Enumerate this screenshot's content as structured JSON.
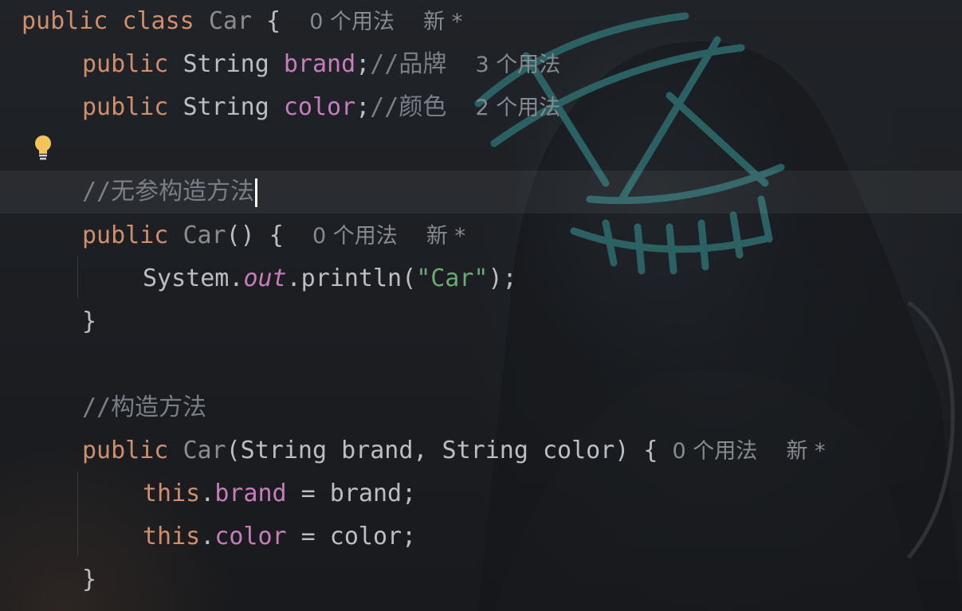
{
  "colors": {
    "keyword": "#cf8e6d",
    "class_name": "#8c8c8c",
    "field": "#c77dbb",
    "string": "#6aab73",
    "comment": "#7a7e85",
    "inlay_hint": "#868a91",
    "background": "#1e1f22",
    "bulb": "#f2c55c"
  },
  "icons": {
    "bulb": "lightbulb-icon"
  },
  "code": {
    "line1": {
      "kw_public": "public",
      "kw_class": "class",
      "name": "Car",
      "brace": "{",
      "hint_usages": "0 个用法",
      "hint_new": "新 *"
    },
    "line2": {
      "kw_public": "public",
      "type": "String",
      "field": "brand",
      "semi": ";",
      "comment": "//品牌",
      "hint_usages": "3 个用法"
    },
    "line3": {
      "kw_public": "public",
      "type": "String",
      "field": "color",
      "semi": ";",
      "comment": "//颜色",
      "hint_usages": "2 个用法"
    },
    "line5": {
      "comment": "//无参构造方法"
    },
    "line6": {
      "kw_public": "public",
      "name": "Car",
      "parens": "() {",
      "hint_usages": "0 个用法",
      "hint_new": "新 *"
    },
    "line7": {
      "system": "System.",
      "out": "out",
      "println": ".println(",
      "string": "\"Car\"",
      "end": ");"
    },
    "line8": {
      "brace": "}"
    },
    "line10": {
      "comment": "//构造方法"
    },
    "line11": {
      "kw_public": "public",
      "name": "Car",
      "params": "(String brand, String color) {",
      "hint_usages": "0 个用法",
      "hint_new": "新 *"
    },
    "line12": {
      "kw_this": "this",
      "dot": ".",
      "field": "brand",
      "rest": " = brand;"
    },
    "line13": {
      "kw_this": "this",
      "dot": ".",
      "field": "color",
      "rest": " = color;"
    },
    "line14": {
      "brace": "}"
    }
  }
}
